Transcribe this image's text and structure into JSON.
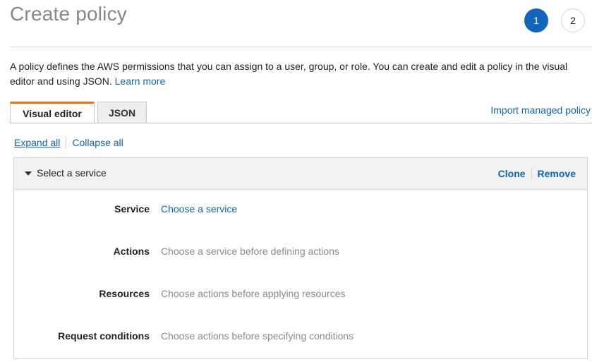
{
  "header": {
    "title": "Create policy",
    "steps": [
      "1",
      "2"
    ]
  },
  "description": {
    "text": "A policy defines the AWS permissions that you can assign to a user, group, or role. You can create and edit a policy in the visual editor and using JSON.",
    "learn_more": "Learn more"
  },
  "tabs": [
    {
      "label": "Visual editor",
      "active": true
    },
    {
      "label": "JSON",
      "active": false
    }
  ],
  "import_link": "Import managed policy",
  "expand_all": "Expand all",
  "collapse_all": "Collapse all",
  "panel": {
    "title": "Select a service",
    "clone": "Clone",
    "remove": "Remove",
    "rows": [
      {
        "label": "Service",
        "value": "Choose a service"
      },
      {
        "label": "Actions",
        "value": "Choose a service before defining actions"
      },
      {
        "label": "Resources",
        "value": "Choose actions before applying resources"
      },
      {
        "label": "Request conditions",
        "value": "Choose actions before specifying conditions"
      }
    ]
  },
  "colors": {
    "link": "#0b66b8",
    "active_step": "#1166bb",
    "active_tab_accent": "#e47911"
  }
}
